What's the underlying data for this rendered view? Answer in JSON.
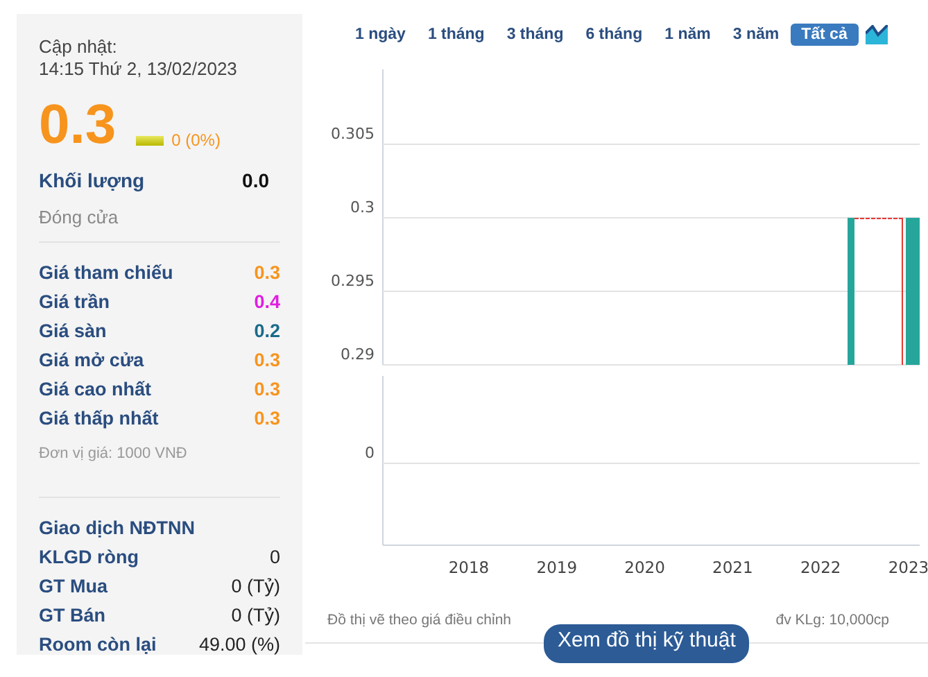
{
  "sidebar": {
    "update_label": "Cập nhật:",
    "update_time": "14:15 Thứ 2, 13/02/2023",
    "price": "0.3",
    "change": "0 (0%)",
    "unchanged": true,
    "volume_label": "Khối lượng",
    "volume": "0.0",
    "session_status": "Đóng cửa",
    "prices": [
      {
        "label": "Giá tham chiếu",
        "value": "0.3",
        "color": "#f7941d"
      },
      {
        "label": "Giá trần",
        "value": "0.4",
        "color": "#e01ee0"
      },
      {
        "label": "Giá sàn",
        "value": "0.2",
        "color": "#1a6a8a"
      },
      {
        "label": "Giá mở cửa",
        "value": "0.3",
        "color": "#f7941d"
      },
      {
        "label": "Giá cao nhất",
        "value": "0.3",
        "color": "#f7941d"
      },
      {
        "label": "Giá thấp nhất",
        "value": "0.3",
        "color": "#f7941d"
      }
    ],
    "unit_note": "Đơn vị giá: 1000 VNĐ",
    "foreign_title": "Giao dịch NĐTNN",
    "foreign_rows": [
      {
        "label": "KLGD ròng",
        "value": "0"
      },
      {
        "label": "GT Mua",
        "value": "0 (Tỷ)"
      },
      {
        "label": "GT Bán",
        "value": "0 (Tỷ)"
      },
      {
        "label": "Room còn lại",
        "value": "49.00 (%)"
      }
    ]
  },
  "range_tabs": [
    {
      "label": "1 ngày",
      "selected": false
    },
    {
      "label": "1 tháng",
      "selected": false
    },
    {
      "label": "3 tháng",
      "selected": false
    },
    {
      "label": "6 tháng",
      "selected": false
    },
    {
      "label": "1 năm",
      "selected": false
    },
    {
      "label": "3 năm",
      "selected": false
    },
    {
      "label": "Tất cả",
      "selected": true
    }
  ],
  "price_chart": {
    "y_labels": [
      "0.305",
      "0.3",
      "0.295",
      "0.29"
    ]
  },
  "volume_chart": {
    "y_label": "0",
    "x_labels": [
      "2018",
      "2019",
      "2020",
      "2021",
      "2022",
      "2023"
    ]
  },
  "notes": [
    "Đồ thị vẽ theo giá điều chỉnh",
    "đv KLg: 10,000cp"
  ],
  "technical_button": "Xem đồ thị kỹ thuật"
}
